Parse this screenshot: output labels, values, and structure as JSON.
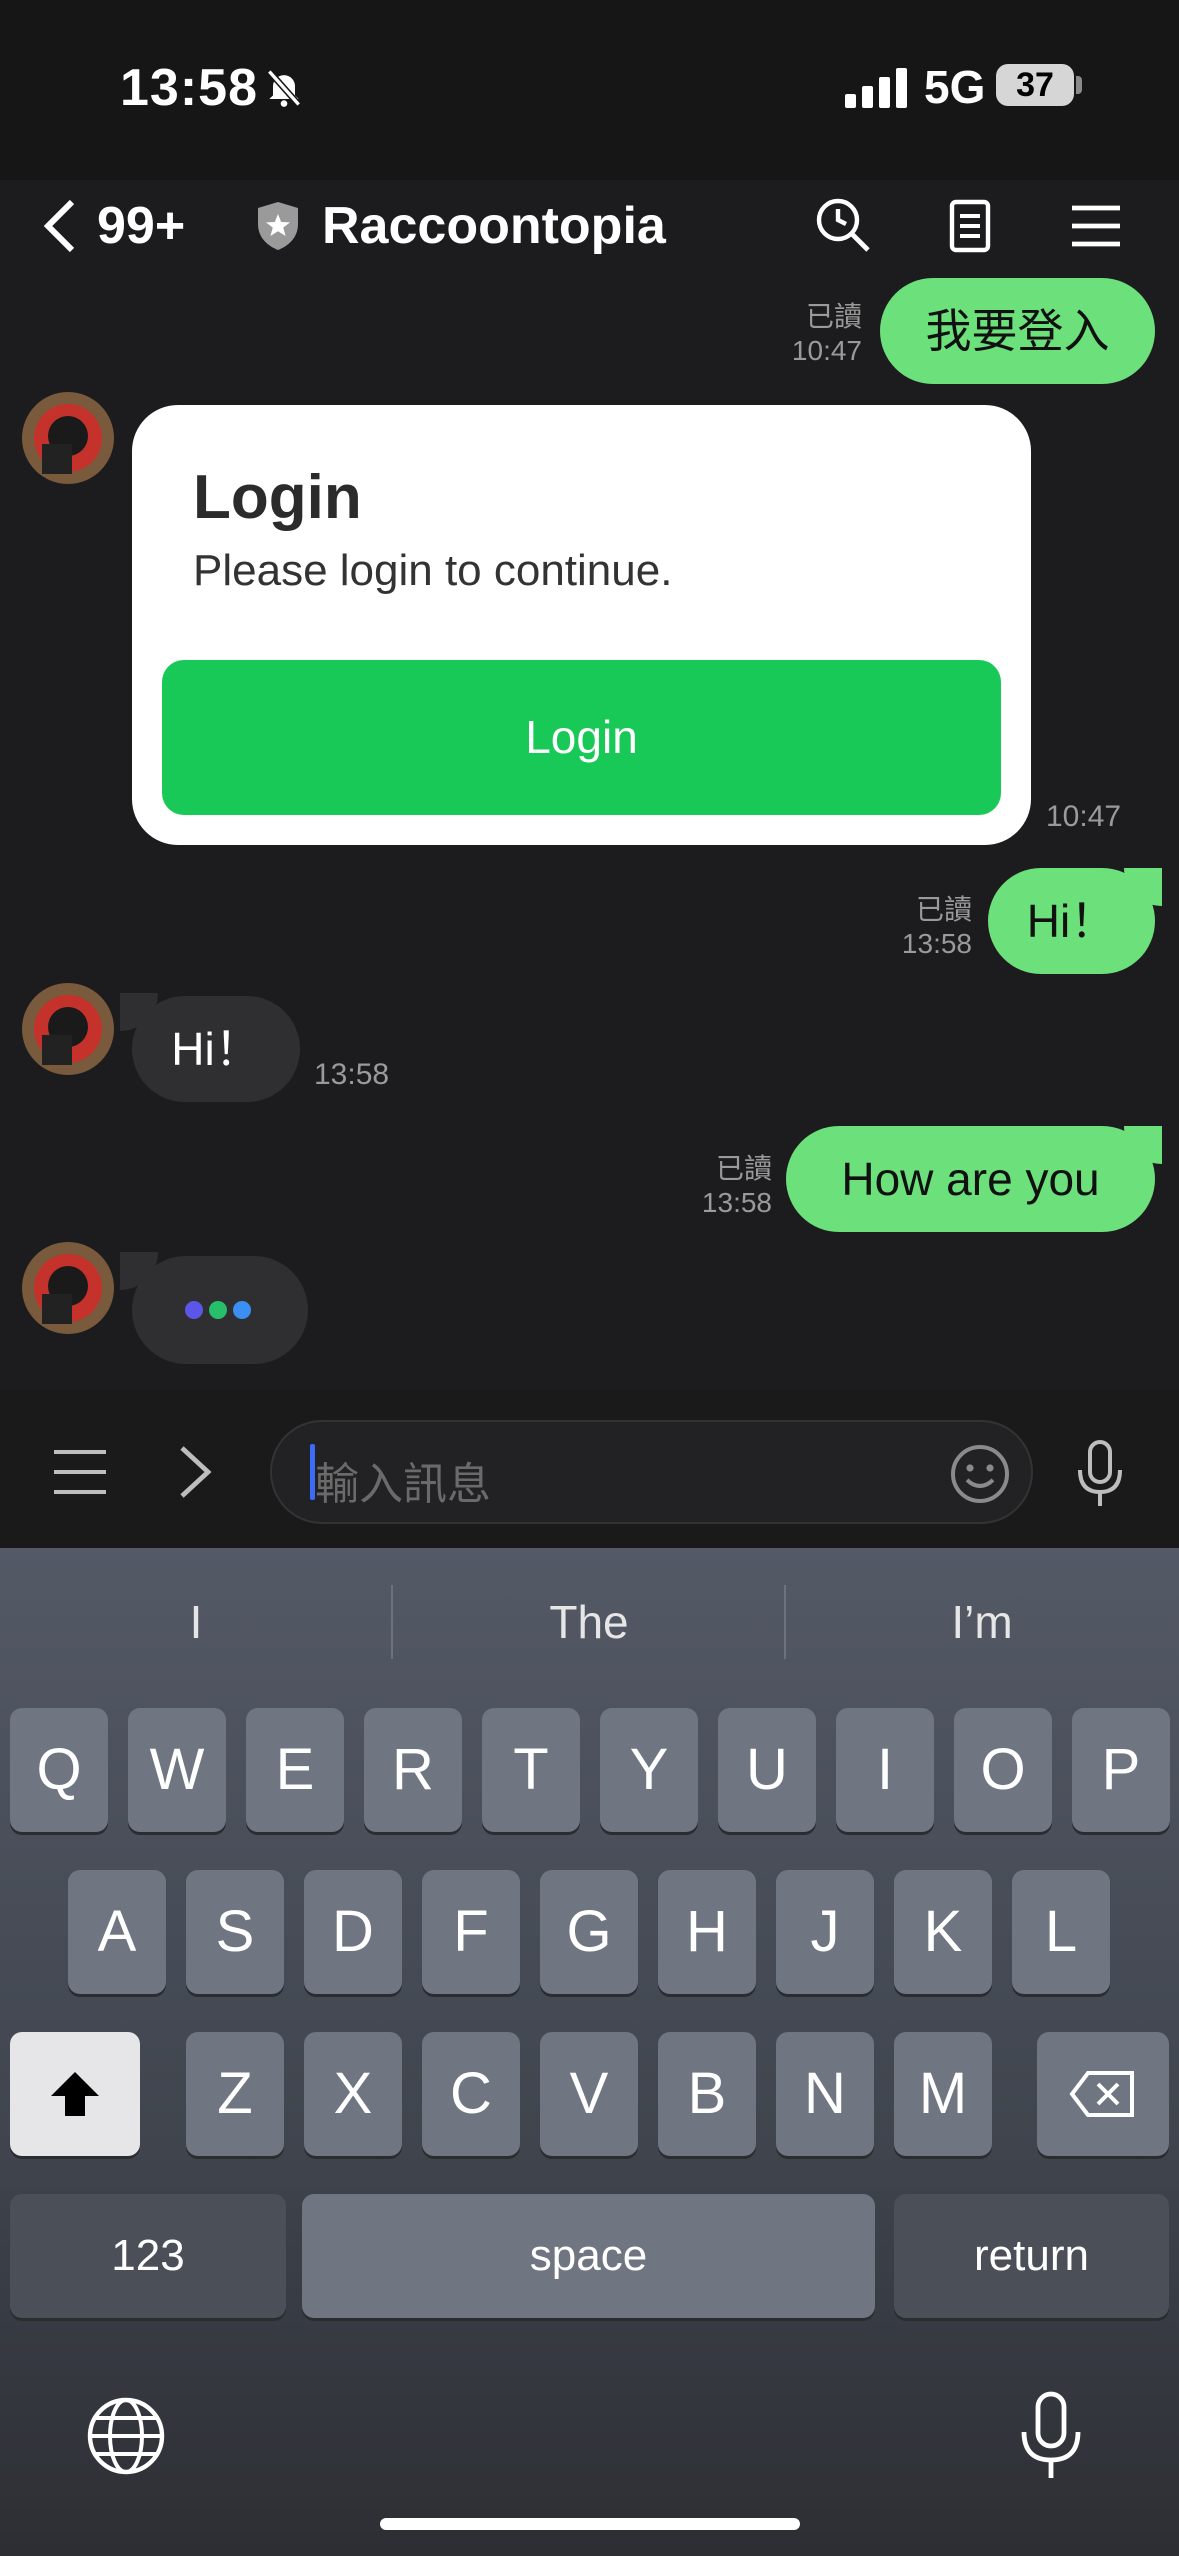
{
  "status": {
    "time": "13:58",
    "network": "5G",
    "battery": "37"
  },
  "header": {
    "back_count": "99+",
    "title": "Raccoontopia"
  },
  "messages": {
    "m1": {
      "read": "已讀",
      "time": "10:47",
      "text": "我要登入"
    },
    "card": {
      "title": "Login",
      "subtitle": "Please login to continue.",
      "button": "Login",
      "time": "10:47"
    },
    "m2": {
      "read": "已讀",
      "time": "13:58",
      "text": "Hi！"
    },
    "m3": {
      "text": "Hi！",
      "time": "13:58"
    },
    "m4": {
      "read": "已讀",
      "time": "13:58",
      "text": "How are you"
    }
  },
  "input": {
    "placeholder": "輸入訊息"
  },
  "keyboard": {
    "suggestions": [
      "I",
      "The",
      "I’m"
    ],
    "row1": [
      "Q",
      "W",
      "E",
      "R",
      "T",
      "Y",
      "U",
      "I",
      "O",
      "P"
    ],
    "row2": [
      "A",
      "S",
      "D",
      "F",
      "G",
      "H",
      "J",
      "K",
      "L"
    ],
    "row3": [
      "Z",
      "X",
      "C",
      "V",
      "B",
      "N",
      "M"
    ],
    "numbers_label": "123",
    "space_label": "space",
    "return_label": "return"
  },
  "colors": {
    "my_bubble": "#6ce07a",
    "login_button": "#18c957",
    "caret": "#3b6cf7"
  }
}
